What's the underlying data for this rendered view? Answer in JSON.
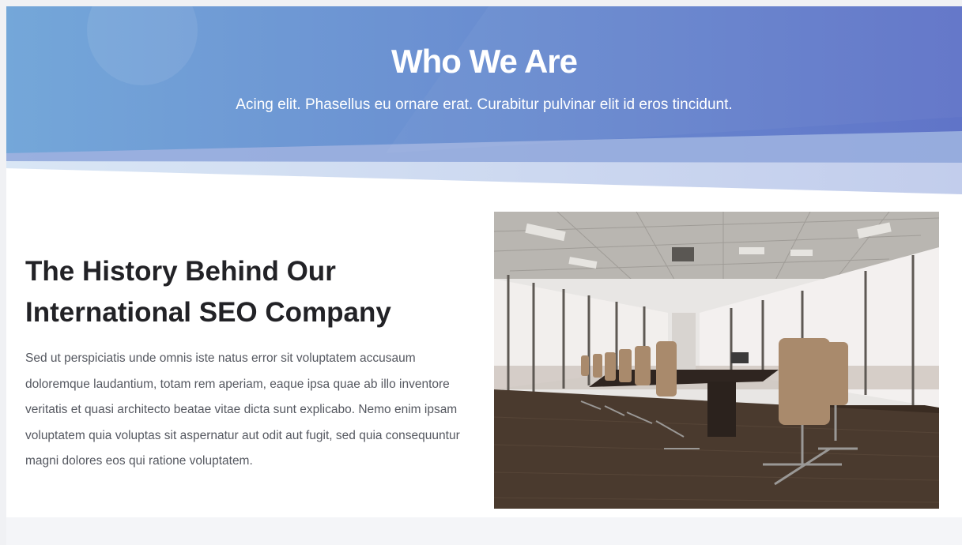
{
  "hero": {
    "title": "Who We Are",
    "subtitle": "Acing elit. Phasellus eu ornare erat. Curabitur pulvinar elit id eros tincidunt.",
    "gradient_start": "#74a7d9",
    "gradient_end": "#6074c8"
  },
  "history": {
    "heading": "The History Behind Our International SEO Company",
    "body": "Sed ut perspiciatis unde omnis iste natus error sit voluptatem accusaum doloremque laudantium, totam rem aperiam, eaque ipsa quae ab illo inventore veritatis et quasi architecto beatae vitae dicta sunt explicabo. Nemo enim ipsam voluptatem quia voluptas sit aspernatur aut odit aut fugit, sed quia consequuntur magni dolores eos qui ratione voluptatem."
  },
  "photo": {
    "subject": "conference-room-photo"
  },
  "colors": {
    "heading_text": "#222226",
    "body_text": "#555860",
    "page_background": "#ffffff"
  }
}
